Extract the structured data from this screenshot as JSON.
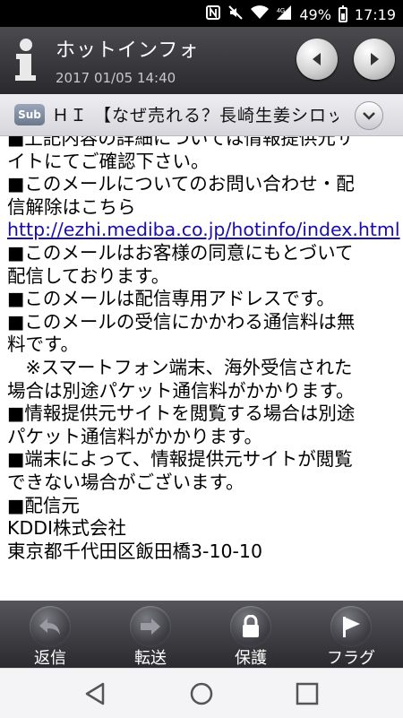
{
  "status": {
    "battery": "49%",
    "time": "17:19"
  },
  "header": {
    "title": "ホットインフォ",
    "date": "2017 01/05 14:40"
  },
  "subbar": {
    "tag": "Sub",
    "subject": "ＨＩ 【なぜ売れる？長崎生姜シロッ"
  },
  "body": {
    "lines": [
      "■上記内容の詳細については情報提供元サ",
      "イトにてご確認下さい。",
      "■このメールについてのお問い合わせ・配",
      "信解除はこちら",
      "http://ezhi.mediba.co.jp/hotinfo/index.html",
      "■このメールはお客様の同意にもとづいて",
      "配信しております。",
      "■このメールは配信専用アドレスです。",
      "■このメールの受信にかかわる通信料は無",
      "料です。",
      "　※スマートフォン端末、海外受信された",
      "場合は別途パケット通信料がかかります。",
      "■情報提供元サイトを閲覧する場合は別途",
      "パケット通信料がかかります。",
      "■端末によって、情報提供元サイトが閲覧",
      "できない場合がございます。",
      "■配信元",
      "KDDI株式会社",
      "東京都千代田区飯田橋3-10-10"
    ]
  },
  "toolbar": {
    "reply": "返信",
    "forward": "転送",
    "protect": "保護",
    "flag": "フラグ"
  }
}
